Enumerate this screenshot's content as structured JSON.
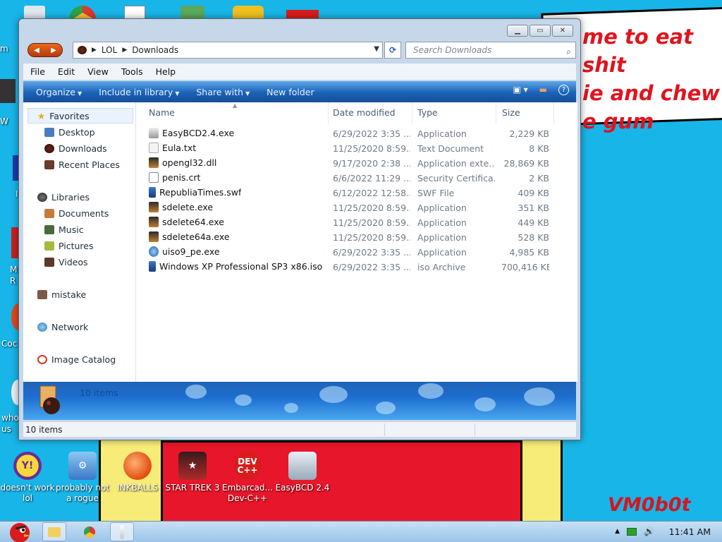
{
  "desktop": {
    "speech_text": "me to eat shit\nie and chew\ne gum",
    "signature": "VM0b0t",
    "bottom_icons": [
      {
        "label": "doesn't work lol"
      },
      {
        "label": "probably not a rogue"
      },
      {
        "label": "INKBALLS"
      },
      {
        "label": "STAR TREK 3"
      },
      {
        "label": "Embarcad... Dev-C++"
      },
      {
        "label": "EasyBCD 2.4"
      }
    ],
    "edge_labels": [
      "m",
      "W",
      "I",
      "M R",
      "Coc",
      "who us"
    ]
  },
  "window": {
    "address": {
      "segments": [
        "LOL",
        "Downloads"
      ]
    },
    "search_placeholder": "Search Downloads",
    "menu": [
      "File",
      "Edit",
      "View",
      "Tools",
      "Help"
    ],
    "toolbar": {
      "organize": "Organize",
      "include": "Include in library",
      "share": "Share with",
      "new_folder": "New folder"
    },
    "nav": {
      "favorites": "Favorites",
      "desktop": "Desktop",
      "downloads": "Downloads",
      "recent": "Recent Places",
      "libraries": "Libraries",
      "documents": "Documents",
      "music": "Music",
      "pictures": "Pictures",
      "videos": "Videos",
      "mistake": "mistake",
      "network": "Network",
      "image_catalog": "Image Catalog"
    },
    "columns": {
      "name": "Name",
      "date": "Date modified",
      "type": "Type",
      "size": "Size"
    },
    "files": [
      {
        "name": "EasyBCD2.4.exe",
        "date": "6/29/2022 3:35 ...",
        "type": "Application",
        "size": "2,229 KB",
        "icon": "installer-icon"
      },
      {
        "name": "Eula.txt",
        "date": "11/25/2020 8:59...",
        "type": "Text Document",
        "size": "8 KB",
        "icon": "text-file-icon"
      },
      {
        "name": "opengl32.dll",
        "date": "9/17/2020 2:38 ...",
        "type": "Application exte...",
        "size": "28,869 KB",
        "icon": "dll-icon"
      },
      {
        "name": "penis.crt",
        "date": "6/6/2022 11:29 ...",
        "type": "Security Certifica...",
        "size": "2 KB",
        "icon": "certificate-icon"
      },
      {
        "name": "RepubliaTimes.swf",
        "date": "6/12/2022 12:58...",
        "type": "SWF File",
        "size": "409 KB",
        "icon": "swf-icon"
      },
      {
        "name": "sdelete.exe",
        "date": "11/25/2020 8:59...",
        "type": "Application",
        "size": "351 KB",
        "icon": "exe-icon"
      },
      {
        "name": "sdelete64.exe",
        "date": "11/25/2020 8:59...",
        "type": "Application",
        "size": "449 KB",
        "icon": "exe-icon"
      },
      {
        "name": "sdelete64a.exe",
        "date": "11/25/2020 8:59...",
        "type": "Application",
        "size": "528 KB",
        "icon": "exe-icon"
      },
      {
        "name": "uiso9_pe.exe",
        "date": "6/29/2022 3:35 ...",
        "type": "Application",
        "size": "4,985 KB",
        "icon": "globe-installer-icon"
      },
      {
        "name": "Windows XP Professional SP3 x86.iso",
        "date": "6/29/2022 3:35 ...",
        "type": "iso Archive",
        "size": "700,416 KB",
        "icon": "iso-icon"
      }
    ],
    "details_count": "10 items",
    "status_count": "10 items"
  },
  "taskbar": {
    "clock": "11:41 AM"
  },
  "colors": {
    "accent": "#1c64b8",
    "desktop": "#18b5e8",
    "speech_text": "#e0141e"
  }
}
